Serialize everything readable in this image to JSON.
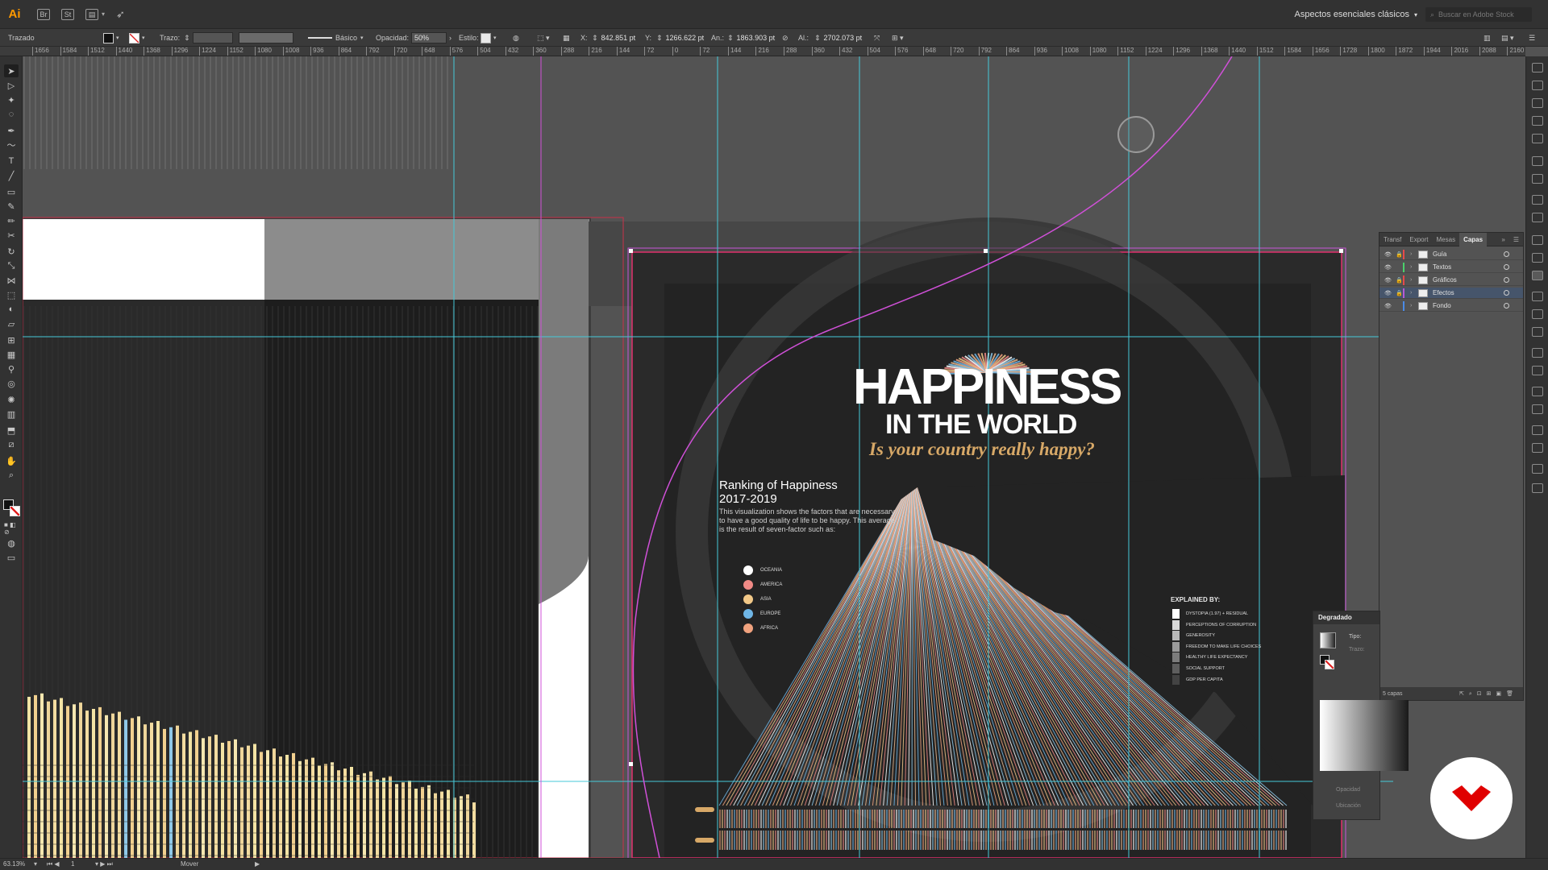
{
  "app": {
    "logo": "Ai"
  },
  "menubar": {
    "workspace": "Aspectos esenciales clásicos",
    "search_placeholder": "Buscar en Adobe Stock"
  },
  "controlbar": {
    "selection_label": "Trazado",
    "stroke_label": "Trazo:",
    "brush_label": "Básico",
    "opacity_label": "Opacidad:",
    "opacity_value": "50%",
    "style_label": "Estilo:",
    "x_label": "X:",
    "x_value": "842.851 pt",
    "y_label": "Y:",
    "y_value": "1266.622 pt",
    "w_label": "An.:",
    "w_value": "1863.903 pt",
    "h_label": "Al.:",
    "h_value": "2702.073 pt"
  },
  "ruler": {
    "ticks": [
      "1656",
      "1584",
      "1512",
      "1440",
      "1368",
      "1296",
      "1224",
      "1152",
      "1080",
      "1008",
      "936",
      "864",
      "792",
      "720",
      "648",
      "576",
      "504",
      "432",
      "360",
      "288",
      "216",
      "144",
      "72",
      "0",
      "72",
      "144",
      "216",
      "288",
      "360",
      "432",
      "504",
      "576",
      "648",
      "720",
      "792",
      "864",
      "936",
      "1008",
      "1080",
      "1152",
      "1224",
      "1296",
      "1368",
      "1440",
      "1512",
      "1584",
      "1656",
      "1728",
      "1800",
      "1872",
      "1944",
      "2016",
      "2088",
      "2160"
    ]
  },
  "artwork": {
    "title_line1": "HAPPINESS",
    "title_line2": "IN THE WORLD",
    "subtitle": "Is your country really happy?",
    "ranking_title": "Ranking of Happiness",
    "ranking_years": "2017-2019",
    "ranking_description": "This visualization shows the factors that are necessary to have a good quality of life to be happy. This average is the result of seven-factor such as:",
    "regions": [
      {
        "label": "OCEANIA",
        "color": "#ffffff"
      },
      {
        "label": "AMERICA",
        "color": "#f08a86"
      },
      {
        "label": "ASIA",
        "color": "#f1c888"
      },
      {
        "label": "EUROPE",
        "color": "#6fb6e6"
      },
      {
        "label": "AFRICA",
        "color": "#f0a27e"
      }
    ],
    "explained_title": "EXPLAINED BY:",
    "factors": [
      {
        "label": "DYSTOPIA (1.97) + RESIDUAL",
        "color": "#ffffff"
      },
      {
        "label": "PERCEPTIONS OF CORRUPTION",
        "color": "#d8d8d8"
      },
      {
        "label": "GENEROSITY",
        "color": "#b9b9b9"
      },
      {
        "label": "FREEDOM TO MAKE LIFE CHOICES",
        "color": "#9a9a9a"
      },
      {
        "label": "HEALTHY LIFE EXPECTANCY",
        "color": "#7c7c7c"
      },
      {
        "label": "SOCIAL SUPPORT",
        "color": "#5e5e5e"
      },
      {
        "label": "GDP PER CAPITA",
        "color": "#434343"
      }
    ]
  },
  "layers_panel": {
    "tabs": [
      "Transf",
      "Export",
      "Mesas",
      "Capas"
    ],
    "active_tab": "Capas",
    "layers": [
      {
        "name": "Guía",
        "color": "#e64b4b"
      },
      {
        "name": "Textos",
        "color": "#4bd06b"
      },
      {
        "name": "Gráficos",
        "color": "#e64b4b"
      },
      {
        "name": "Efectos",
        "color": "#b65ad6"
      },
      {
        "name": "Fondo",
        "color": "#4b8be6"
      }
    ],
    "selected_layer": "Efectos",
    "footer": "5 capas"
  },
  "gradient_panel": {
    "title": "Degradado",
    "type_label": "Tipo:",
    "stroke_label": "Trazo:",
    "opacity_label": "Opacidad",
    "location_label": "Ubicación"
  },
  "statusbar": {
    "zoom": "63.13%",
    "artboard": "1",
    "tool": "Mover"
  },
  "colors": {
    "accent_guides": "#45c8d8",
    "magenta_guides": "#d050d8",
    "artboard_border": "#e1306c",
    "brand_badge": "#e00000"
  }
}
